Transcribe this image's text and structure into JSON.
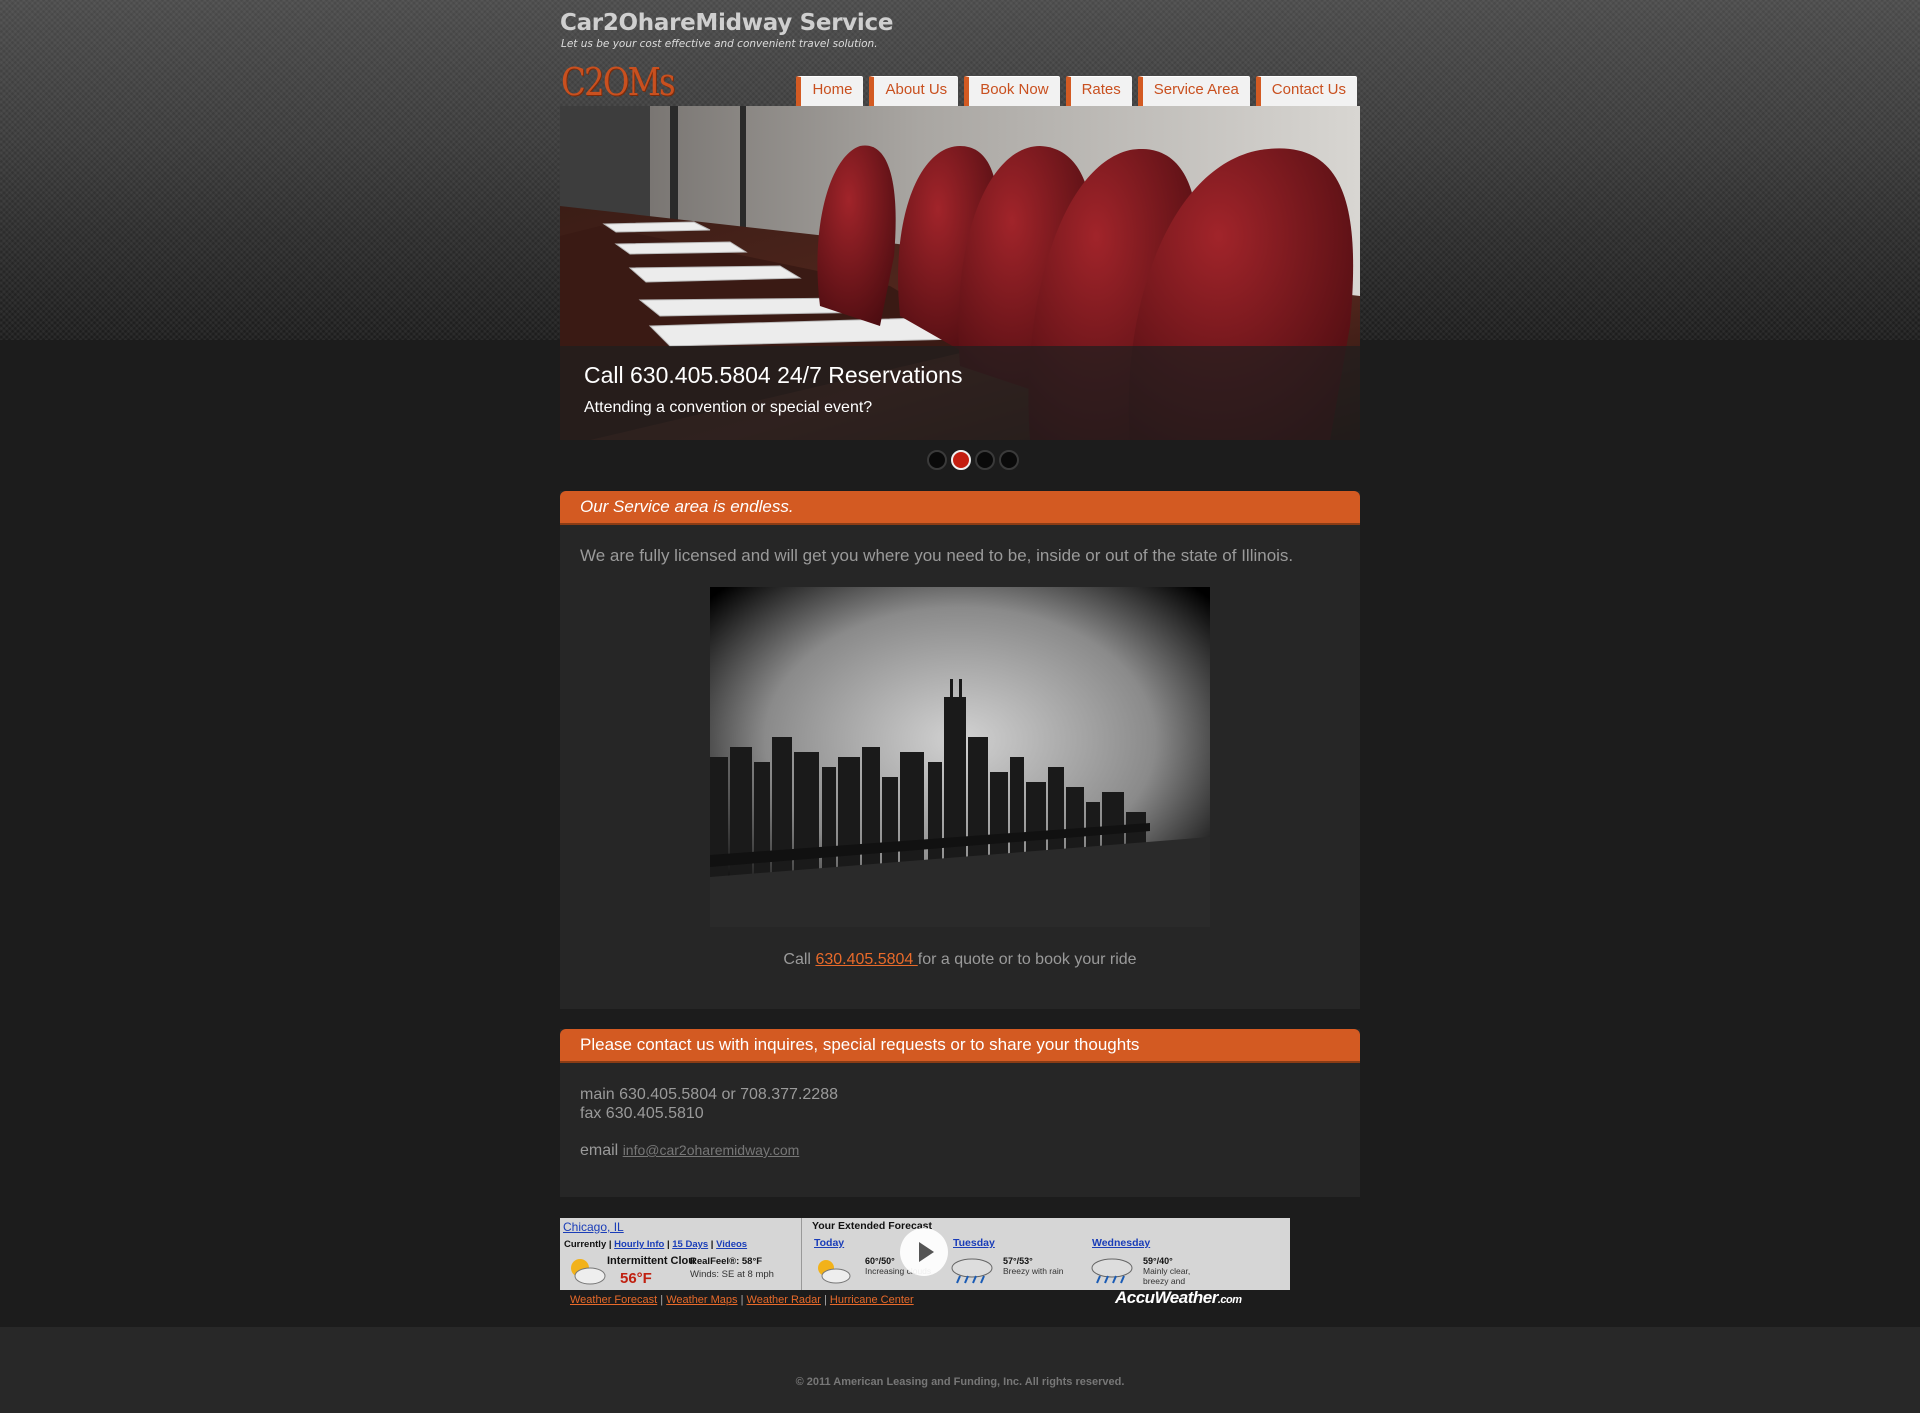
{
  "header": {
    "site_title": "Car2OhareMidway Service",
    "tagline": "Let us be your cost effective and convenient travel solution.",
    "logo_text": "C2OMs"
  },
  "nav": {
    "items": [
      "Home",
      "About Us",
      "Book Now",
      "Rates",
      "Service Area",
      "Contact Us"
    ],
    "accent_color": "#d35a22"
  },
  "slider": {
    "caption_title": "Call 630.405.5804 24/7 Reservations",
    "caption_subtitle": "Attending a convention or special event?",
    "image_description": "conference-room-red-chairs",
    "dots": 4,
    "active_dot": 2
  },
  "service_panel": {
    "heading": "Our Service area is endless.",
    "text": "We are fully licensed and will get you where you need to be, inside or out of the state of Illinois.",
    "image_description": "chicago-skyline-bw",
    "call_prefix": "Call ",
    "call_phone": "630.405.5804 ",
    "call_suffix": "for a quote or to book your ride"
  },
  "contact_panel": {
    "heading": "Please contact us with inquires, special requests or to share your thoughts",
    "main_line": "main 630.405.5804 or 708.377.2288",
    "fax_line": "fax 630.405.5810",
    "email_label": "email ",
    "email": "info@car2oharemidway.com"
  },
  "weather": {
    "city": "Chicago, IL",
    "currently": "Currently",
    "hourly": "Hourly Info",
    "days15": "15 Days",
    "videos": "Videos",
    "condition": "Intermittent Clou",
    "temp": "56°F",
    "realfeel": "RealFeel®: 58°F",
    "wind": "Winds: SE at 8 mph",
    "extended_title": "Your Extended Forecast",
    "forecast": [
      {
        "day": "Today",
        "temps": "60°/50°",
        "desc": "Increasing clouds"
      },
      {
        "day": "Tuesday",
        "temps": "57°/53°",
        "desc": "Breezy with rain"
      },
      {
        "day": "Wednesday",
        "temps": "59°/40°",
        "desc": "Mainly clear, breezy and"
      }
    ],
    "footer_links": [
      "Weather Forecast",
      "Weather Maps",
      "Weather Radar",
      "Hurricane Center"
    ],
    "brand": "AccuWeather",
    "brand_suffix": ".com"
  },
  "footer": {
    "copyright": "© 2011 American Leasing and Funding, Inc. All rights reserved."
  }
}
